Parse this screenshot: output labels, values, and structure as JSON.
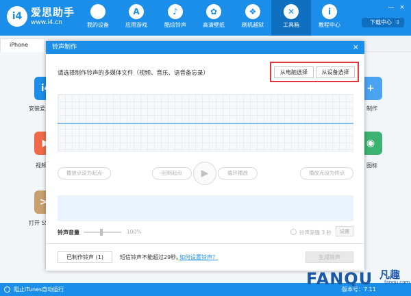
{
  "app": {
    "brand": "爱思助手",
    "url": "www.i4.cn",
    "logo_text": "i4"
  },
  "nav": [
    {
      "label": "我的设备",
      "icon": "apple-icon",
      "glyph": "",
      "active": false
    },
    {
      "label": "应用游戏",
      "icon": "appstore-icon",
      "glyph": "A",
      "active": false
    },
    {
      "label": "酷炫铃声",
      "icon": "bell-icon",
      "glyph": "♪",
      "active": false
    },
    {
      "label": "高清壁纸",
      "icon": "flower-icon",
      "glyph": "✿",
      "active": false
    },
    {
      "label": "刷机越狱",
      "icon": "box-icon",
      "glyph": "❖",
      "active": false
    },
    {
      "label": "工具箱",
      "icon": "tools-icon",
      "glyph": "✕",
      "active": true
    },
    {
      "label": "教程中心",
      "icon": "info-icon",
      "glyph": "i",
      "active": false
    }
  ],
  "download_center": "下载中心",
  "window_controls": {
    "minimize": "—",
    "close": "×"
  },
  "tabs": {
    "device_tab": "iPhone"
  },
  "background_apps": [
    {
      "label": "安装爱思",
      "glyph": "i4",
      "color": "#1a8ee8"
    },
    {
      "label": "视频",
      "glyph": "▶",
      "color": "#f06a4a"
    },
    {
      "label": "打开 SS",
      "glyph": ">_",
      "color": "#c8a070"
    },
    {
      "label": "制作",
      "glyph": "+",
      "color": "#4aa3f0"
    },
    {
      "label": "图标",
      "glyph": "◉",
      "color": "#3cb371"
    }
  ],
  "dialog": {
    "title": "铃声制作",
    "close": "×",
    "prompt": "请选择制作铃声的多媒体文件（视频、音乐、语音备忘录）",
    "from_pc": "从电脑选择",
    "from_device": "从设备选择",
    "set_start": "播放点设为起点",
    "back_to_start": "回到起点",
    "play_glyph": "▶",
    "loop_play": "循环播放",
    "set_end": "播放点设为终点",
    "volume_label": "铃声音量",
    "volume_value": "100%",
    "fade_label": "铃声渐强 3 秒",
    "settings": "设置",
    "made_ringtones": "已制作铃声 (1)",
    "limit_text": "短信铃声不能超过29秒。",
    "howto_link": "如何设置铃声？",
    "generate": "生成铃声"
  },
  "statusbar": {
    "itunes_text": "阻止iTunes自动运行",
    "version": "版本号：7.11"
  },
  "watermark": {
    "text": "FANQU",
    "cn": "凡趣",
    "site": "fanqu.com"
  },
  "colors": {
    "primary": "#1a8ee8",
    "primary_dark": "#0f6fc0",
    "highlight_red": "#e0353b"
  }
}
